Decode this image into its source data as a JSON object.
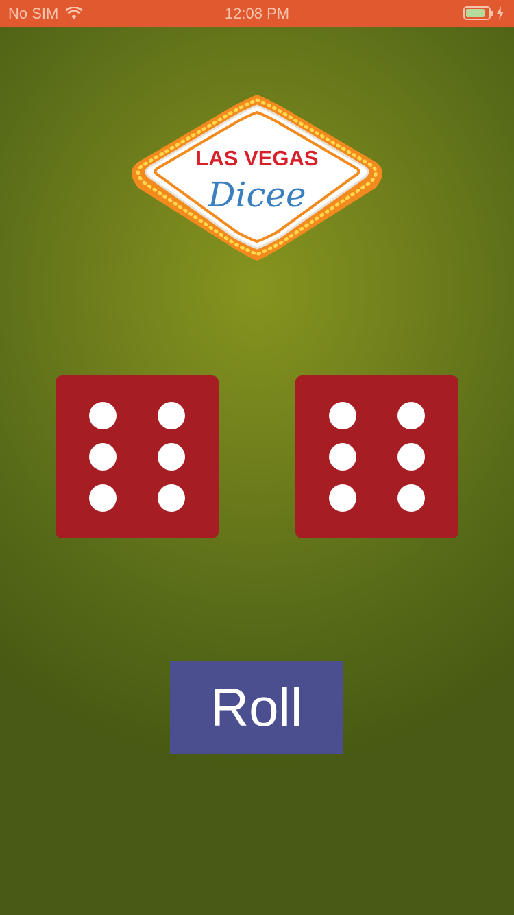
{
  "status_bar": {
    "carrier": "No SIM",
    "time": "12:08 PM",
    "wifi_icon": "wifi-icon",
    "battery_icon": "battery-icon",
    "charging_icon": "charging-bolt-icon",
    "battery_level": 0.74
  },
  "logo": {
    "line1": "LAS VEGAS",
    "line2": "Dicee"
  },
  "dice": [
    {
      "value": 6
    },
    {
      "value": 6
    }
  ],
  "roll_button": {
    "label": "Roll"
  },
  "colors": {
    "status_bar": "#e0592f",
    "background": "#6f7e1c",
    "die": "#a61d24",
    "pip": "#ffffff",
    "button": "#4b4f8f",
    "logo_border": "#f28a1e",
    "logo_red_text": "#d8202a",
    "logo_blue_text": "#3a7fc0"
  }
}
